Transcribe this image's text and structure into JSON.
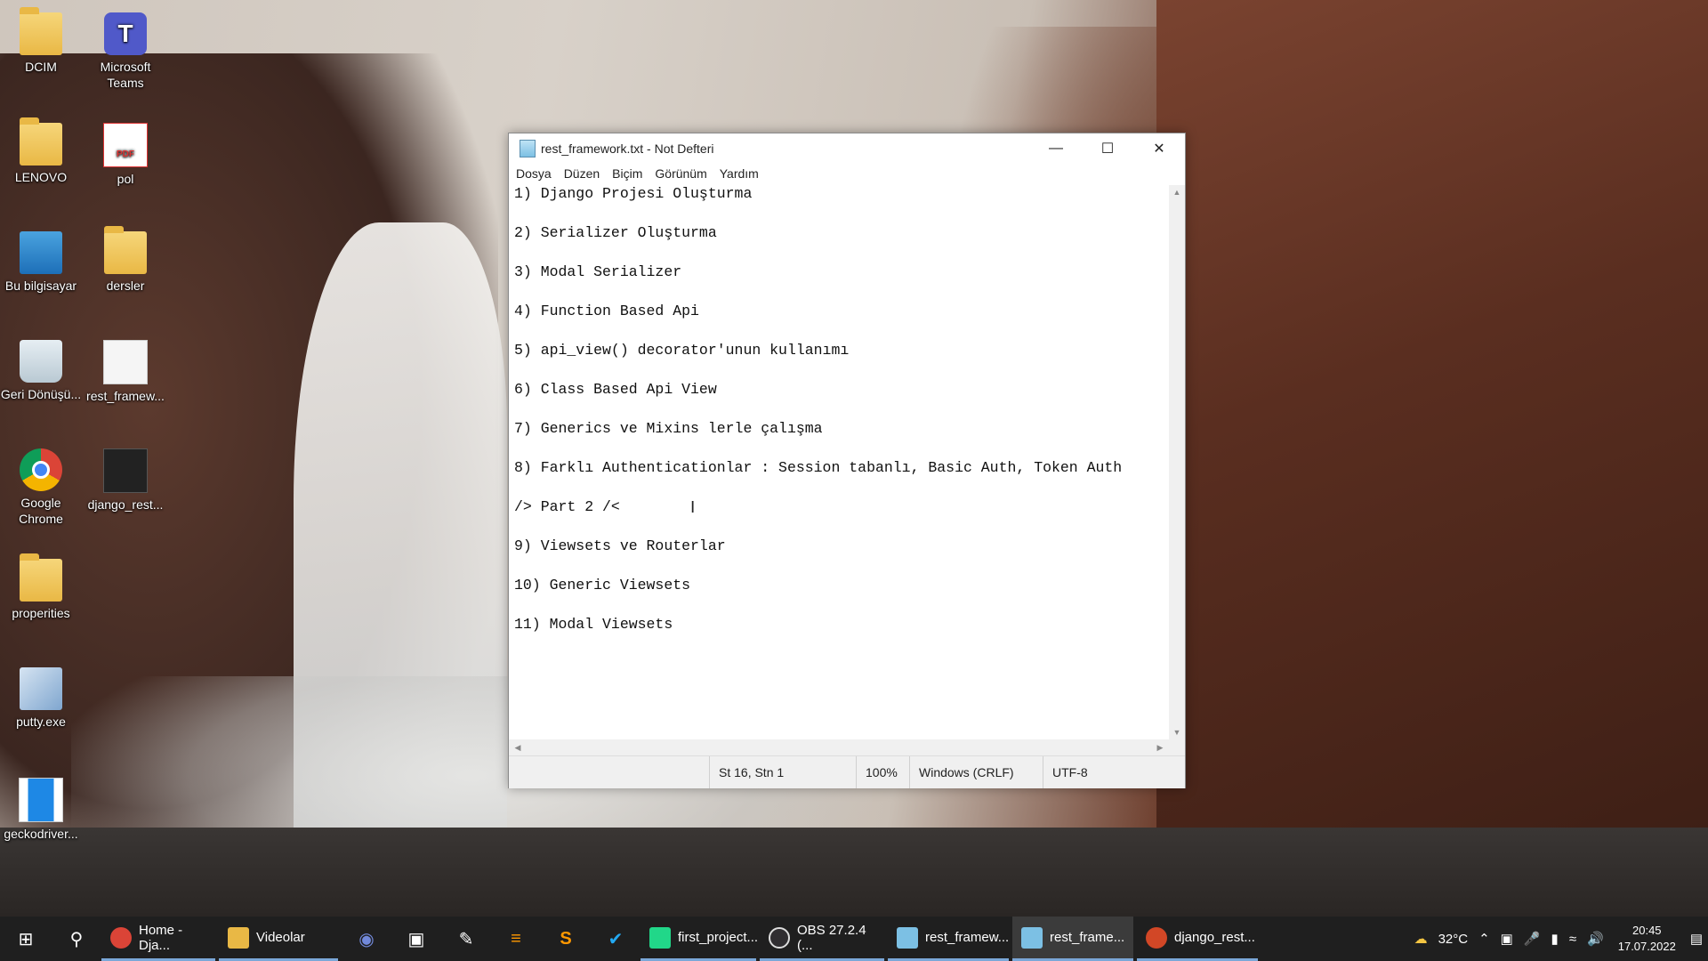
{
  "desktop": {
    "icons": [
      {
        "label": "DCIM",
        "icon": "folder-icon"
      },
      {
        "label": "Microsoft Teams",
        "icon": "teams-icon"
      },
      {
        "label": "LENOVO",
        "icon": "folder-icon"
      },
      {
        "label": "pol",
        "icon": "pdf-icon"
      },
      {
        "label": "Bu bilgisayar",
        "icon": "computer-icon"
      },
      {
        "label": "dersler",
        "icon": "folder-icon"
      },
      {
        "label": "Geri Dönüşü...",
        "icon": "recycle-bin-icon"
      },
      {
        "label": "rest_framew...",
        "icon": "text-file-icon"
      },
      {
        "label": "Google Chrome",
        "icon": "chrome-icon"
      },
      {
        "label": "django_rest...",
        "icon": "video-file-icon"
      },
      {
        "label": "properities",
        "icon": "folder-icon"
      },
      {
        "label": "putty.exe",
        "icon": "putty-icon"
      },
      {
        "label": "geckodriver...",
        "icon": "exe-icon"
      }
    ]
  },
  "notepad": {
    "title": "rest_framework.txt - Not Defteri",
    "menu": [
      "Dosya",
      "Düzen",
      "Biçim",
      "Görünüm",
      "Yardım"
    ],
    "lines": [
      "1) Django Projesi Oluşturma",
      "2) Serializer Oluşturma",
      "3) Modal Serializer",
      "4) Function Based Api",
      "5) api_view() decorator'unun kullanımı",
      "6) Class Based Api View",
      "7) Generics ve Mixins lerle çalışma",
      "8) Farklı Authenticationlar : Session tabanlı, Basic Auth, Token Auth",
      "/> Part 2 /<",
      "9) Viewsets ve Routerlar",
      "10) Generic Viewsets",
      "11) Modal Viewsets"
    ],
    "status": {
      "position": "St 16, Stn 1",
      "zoom": "100%",
      "line_ending": "Windows (CRLF)",
      "encoding": "UTF-8"
    }
  },
  "taskbar": {
    "apps": [
      {
        "label": "Home - Dja...",
        "icon": "chrome-icon",
        "color": "#db4437"
      },
      {
        "label": "Videolar",
        "icon": "file-explorer-icon",
        "color": "#e9b845"
      },
      {
        "label": "first_project...",
        "icon": "pycharm-icon",
        "color": "#21d789"
      },
      {
        "label": "OBS 27.2.4 (...",
        "icon": "obs-icon",
        "color": "#302e31"
      },
      {
        "label": "rest_framew...",
        "icon": "notepad-icon",
        "color": "#7cc0e4"
      },
      {
        "label": "rest_frame...",
        "icon": "notepad-icon",
        "color": "#7cc0e4"
      },
      {
        "label": "django_rest...",
        "icon": "powerpoint-icon",
        "color": "#d24726"
      }
    ],
    "pinned": [
      "discord-icon",
      "terminal-icon",
      "notes-icon",
      "sublime-icon",
      "s-app-icon",
      "vscode-icon"
    ],
    "weather": "32°C",
    "time": "20:45",
    "date": "17.07.2022"
  }
}
